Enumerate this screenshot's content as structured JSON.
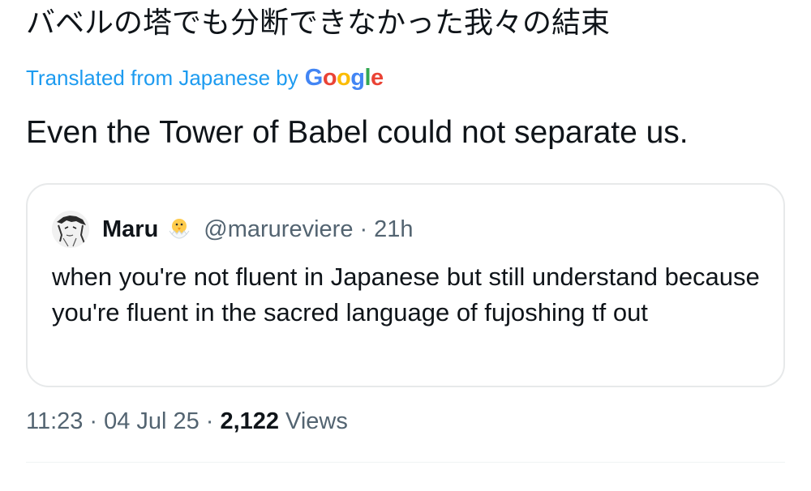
{
  "tweet": {
    "original_text": "バベルの塔でも分断できなかった我々の結束",
    "translation_label": "Translated from Japanese by",
    "translation_provider": "Google",
    "translated_text": "Even the Tower of Babel could not separate us."
  },
  "quote": {
    "display_name": "Maru",
    "emoji": "hatching-chick-icon",
    "handle": "@marureviere",
    "separator": "·",
    "time_ago": "21h",
    "text": "when you're not fluent in Japanese but still understand because you're fluent in the sacred language of fujoshing tf out"
  },
  "meta": {
    "time": "11:23",
    "separator": "·",
    "date": "04 Jul 25",
    "views_count": "2,122",
    "views_label": "Views"
  },
  "colors": {
    "link": "#1d9bf0",
    "text": "#0f1419",
    "secondary": "#536471",
    "border": "#e7e9ea"
  }
}
